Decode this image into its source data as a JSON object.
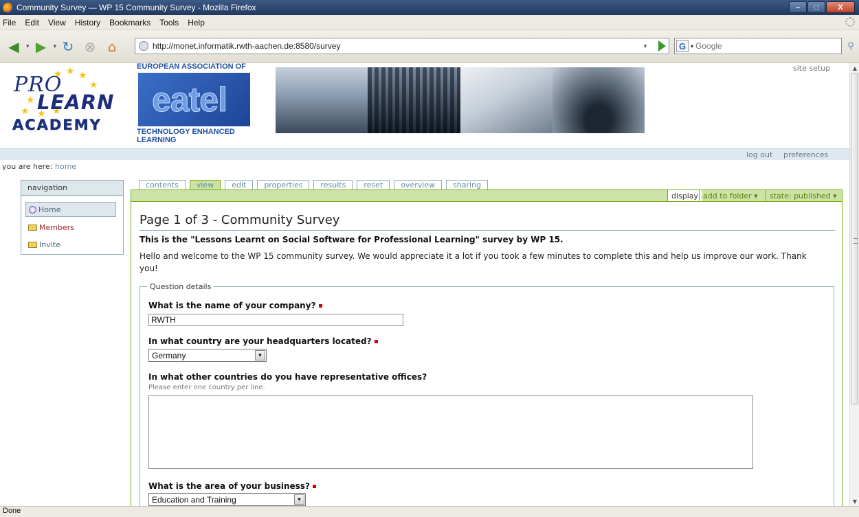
{
  "window": {
    "title": "Community Survey — WP 15 Community Survey - Mozilla Firefox",
    "min_label": "–",
    "max_label": "□",
    "close_label": "X"
  },
  "menu": [
    "File",
    "Edit",
    "View",
    "History",
    "Bookmarks",
    "Tools",
    "Help"
  ],
  "toolbar": {
    "url": "http://monet.informatik.rwth-aachen.de:8580/survey",
    "search_placeholder": "Google",
    "search_engine_letter": "G"
  },
  "header": {
    "logo_pro": "PRO",
    "logo_learn": "LEARN",
    "logo_academy": "ACADEMY",
    "eatel_top": "EUROPEAN ASSOCIATION OF",
    "eatel_word": "eatel",
    "eatel_bottom": "TECHNOLOGY ENHANCED LEARNING",
    "site_setup": "site setup"
  },
  "personal_bar": {
    "logout": "log out",
    "preferences": "preferences"
  },
  "breadcrumb": {
    "prefix": "you are here:",
    "home": "home"
  },
  "navigation": {
    "title": "navigation",
    "items": [
      "Home",
      "Members",
      "Invite"
    ]
  },
  "tabs": [
    "contents",
    "view",
    "edit",
    "properties",
    "results",
    "reset",
    "overview",
    "sharing"
  ],
  "selected_tab": "view",
  "actions": {
    "display": "display",
    "add_to_folder": "add to folder ▾",
    "state": "state: published ▾"
  },
  "page": {
    "title": "Page 1 of 3 - Community Survey",
    "description": "This is the \"Lessons Learnt on Social Software for Professional Learning\" survey by WP 15.",
    "intro": "Hello and welcome to the WP 15 community survey. We would appreciate it a lot if you took a few minutes to complete this and help us improve our work. Thank you!",
    "fieldset_legend": "Question details"
  },
  "questions": {
    "company_label": "What is the name of your company?",
    "company_value": "RWTH",
    "hq_label": "In what country are your headquarters located?",
    "hq_value": "Germany",
    "offices_label": "In what other countries do you have representative offices?",
    "offices_help": "Please enter one country per line.",
    "area_label": "What is the area of your business?",
    "area_value": "Education and Training"
  },
  "status": "Done",
  "colors": {
    "accent_green": "#cde2a7",
    "border_green": "#74ae0b",
    "portlet_blue": "#dee7ec",
    "required_red": "#dd0000"
  }
}
